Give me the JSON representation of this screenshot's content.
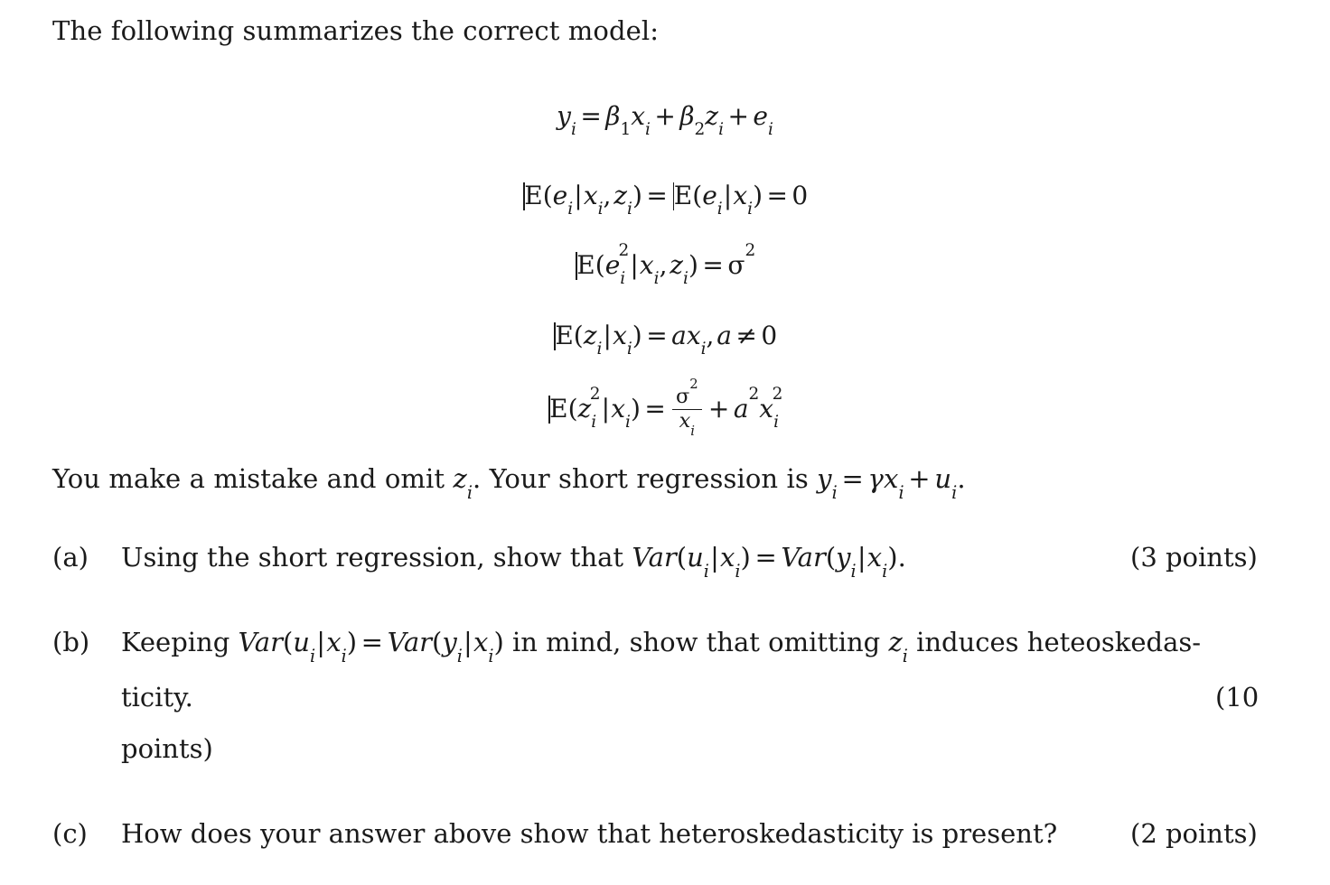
{
  "document": {
    "intro": "The following summarizes the correct model:",
    "equations": [
      {
        "id": "eq-model",
        "latex": "y_i = \\beta_1 x_i + \\beta_2 z_i + e_i"
      },
      {
        "id": "eq-mean-zero",
        "latex": "E(e_i|x_i, z_i) = E(e_i|x_i) = 0"
      },
      {
        "id": "eq-homoskedastic",
        "latex": "E(e_i^2|x_i, z_i) = \\sigma^2"
      },
      {
        "id": "eq-z-mean",
        "latex": "E(z_i|x_i) = a x_i, a \\neq 0"
      },
      {
        "id": "eq-z-second",
        "latex": "E(z_i^2|x_i) = \\frac{\\sigma^2}{x_i} + a^2 x_i^2"
      }
    ],
    "omission_note": {
      "part1": "You make a mistake and omit ",
      "symbol_z": "z",
      "part2": ". Your short regression is ",
      "short_regression": "y_i = \\gamma x_i + u_i",
      "part3": "."
    },
    "questions": [
      {
        "label": "(a)",
        "text_before": "Using the short regression, show that ",
        "math": "Var(u_i|x_i) = Var(y_i|x_i)",
        "text_after": ".",
        "points": "(3 points)"
      },
      {
        "label": "(b)",
        "text_before": "Keeping ",
        "math": "Var(u_i|x_i) = Var(y_i|x_i)",
        "text_mid": " in mind, show that omitting ",
        "symbol_z": "z",
        "text_after": " induces heteoskedas-",
        "continuation_line": "ticity.",
        "continuation_line2": "points)",
        "points": "(10"
      },
      {
        "label": "(c)",
        "text_before": "How does your answer above show that heteroskedasticity is present?",
        "points": "(2 points)"
      }
    ],
    "symbols": {
      "E": "E",
      "sigma": "σ",
      "gamma": "γ",
      "beta": "β",
      "neq": "≠",
      "eq": "=",
      "plus": "+",
      "bar": "|",
      "lparen": "(",
      "rparen": ")",
      "comma": ",",
      "zero": "0",
      "one": "1",
      "two": "2",
      "a": "a",
      "x": "x",
      "y": "y",
      "z": "z",
      "e": "e",
      "u": "u",
      "i": "i",
      "Var": "Var"
    },
    "colors": {
      "background": "#ffffff",
      "text": "#1a1a1a"
    }
  }
}
